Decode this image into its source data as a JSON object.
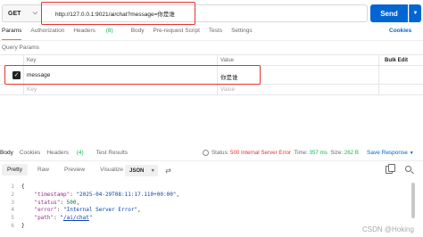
{
  "request": {
    "method": "GET",
    "url": "http://127.0.0.1:9021/ai/chat?message=你是谁",
    "send_label": "Send"
  },
  "request_tabs": {
    "params": "Params",
    "authorization": "Authorization",
    "headers": "Headers",
    "headers_count": "(8)",
    "body": "Body",
    "prerequest": "Pre-request Script",
    "tests": "Tests",
    "settings": "Settings",
    "cookies": "Cookies"
  },
  "query_params": {
    "title": "Query Params",
    "columns": {
      "key": "Key",
      "value": "Value",
      "bulk_edit": "Bulk Edit"
    },
    "row": {
      "key": "message",
      "value": "你是谁",
      "checked": true
    },
    "placeholder": {
      "key": "Key",
      "value": "Value"
    }
  },
  "response_tabs": {
    "body": "Body",
    "cookies": "Cookies",
    "headers": "Headers",
    "headers_count": "(4)",
    "test_results": "Test Results"
  },
  "response_status": {
    "status_label": "Status:",
    "status_value": "500 Internal Server Error",
    "time_label": "Time:",
    "time_value": "357 ms",
    "size_label": "Size:",
    "size_value": "262 B",
    "save_label": "Save Response"
  },
  "view_tabs": {
    "pretty": "Pretty",
    "raw": "Raw",
    "preview": "Preview",
    "visualize": "Visualize",
    "format": "JSON"
  },
  "response_body": {
    "line_numbers": [
      "1",
      "2",
      "3",
      "4",
      "5",
      "6"
    ],
    "open_brace": "{",
    "close_brace": "}",
    "timestamp_key": "\"timestamp\"",
    "timestamp_value": "\"2025-04-29T08:11:17.110+00:00\"",
    "status_key": "\"status\"",
    "status_value": "500",
    "error_key": "\"error\"",
    "error_value": "\"Internal Server Error\"",
    "path_key": "\"path\"",
    "path_value": "/ai/chat"
  },
  "watermark": "CSDN @Hoking",
  "colors": {
    "accent_orange": "#ff6c37",
    "send_blue": "#0265d2",
    "error_red": "#e8322f",
    "success_green": "#0cbb52"
  }
}
